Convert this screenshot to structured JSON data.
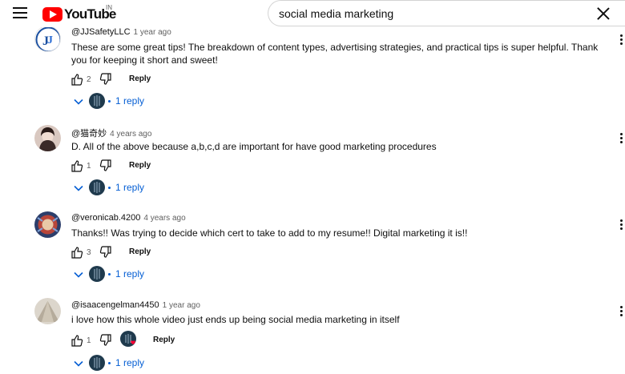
{
  "header": {
    "logo_text": "YouTube",
    "country_code": "IN",
    "search_query": "social media marketing"
  },
  "comments": [
    {
      "author": "@JJSafetyLLC",
      "time": "1 year ago",
      "text": "These are some great tips!  The breakdown of content types, advertising strategies, and practical tips is super helpful. Thank you for keeping it short and sweet!",
      "likes": "2",
      "reply_label": "Reply",
      "reply_count": "1 reply",
      "creator_hearted": false
    },
    {
      "author": "@猫奇妙",
      "time": "4 years ago",
      "text": "D.  All of the above because a,b,c,d are important for have good marketing procedures",
      "likes": "1",
      "reply_label": "Reply",
      "reply_count": "1 reply",
      "creator_hearted": false
    },
    {
      "author": "@veronicab.4200",
      "time": "4 years ago",
      "text": "Thanks!! Was trying to decide which cert to take to add to my resume!! Digital marketing it is!!",
      "likes": "3",
      "reply_label": "Reply",
      "reply_count": "1 reply",
      "creator_hearted": false
    },
    {
      "author": "@isaacengelman4450",
      "time": "1 year ago",
      "text": "i love how this whole video just ends up being social media marketing in itself",
      "likes": "1",
      "reply_label": "Reply",
      "reply_count": "1 reply",
      "creator_hearted": true
    }
  ],
  "colors": {
    "brand_red": "#ff0000",
    "link_blue": "#065fd4",
    "muted_text": "#606060",
    "creator_avatar": "#1f3a4d",
    "heart": "#ff0033"
  }
}
